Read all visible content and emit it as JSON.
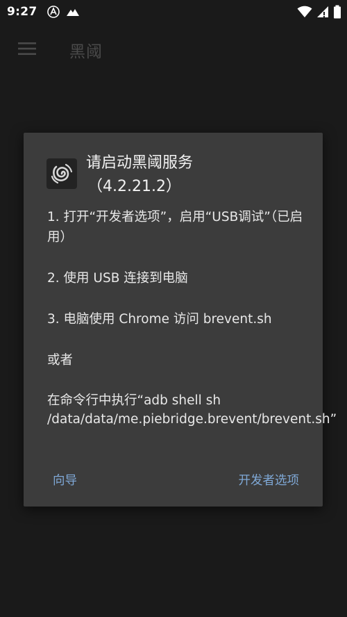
{
  "status_bar": {
    "time": "9:27",
    "icons_left": [
      "accessibility-icon",
      "mountain-notification-icon"
    ],
    "icons_right": [
      "wifi-icon",
      "cell-signal-icon",
      "battery-icon"
    ]
  },
  "app_bar": {
    "title": "黑阈",
    "menu_icon": "hamburger-menu-icon"
  },
  "dialog": {
    "title": "请启动黑阈服务",
    "version": "（4.2.21.2）",
    "logo_icon": "brevent-swirl-logo-icon",
    "steps": [
      "1. 打开“开发者选项”，启用“USB调试”（已启用）",
      "2. 使用 USB 连接到电脑",
      "3. 电脑使用 Chrome 访问 brevent.sh",
      "或者",
      "在命令行中执行“adb shell sh /data/data/me.piebridge.brevent/brevent.sh”"
    ],
    "actions": {
      "guide": "向导",
      "developer_options": "开发者选项"
    }
  },
  "colors": {
    "background": "#1a1a1a",
    "dialog": "#3c3c3c",
    "accent": "#7fa8d6",
    "app_title": "#4a4a4a"
  }
}
